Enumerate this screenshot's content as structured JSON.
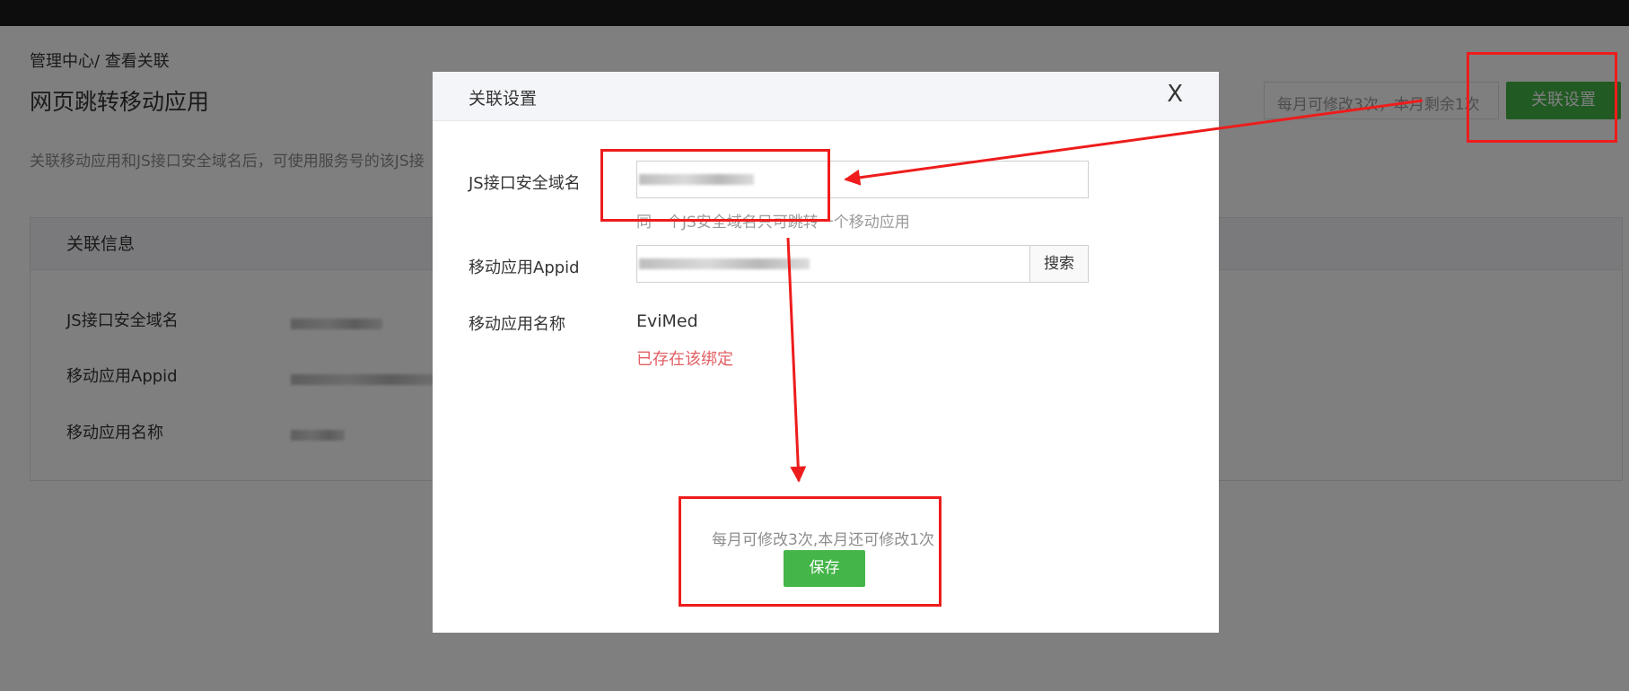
{
  "page": {
    "breadcrumb": "管理中心/ 查看关联",
    "title": "网页跳转移动应用",
    "quota_text": "每月可修改3次，本月剩余1次",
    "link_settings_button": "关联设置",
    "intro": "关联移动应用和JS接口安全域名后，可使用服务号的该JS接"
  },
  "info_card": {
    "header": "关联信息",
    "rows": [
      {
        "label": "JS接口安全域名"
      },
      {
        "label": "移动应用Appid"
      },
      {
        "label": "移动应用名称"
      }
    ]
  },
  "dialog": {
    "title": "关联设置",
    "close": "X",
    "js_domain_label": "JS接口安全域名",
    "js_domain_tip": "同一个JS安全域名只可跳转一个移动应用",
    "appid_label": "移动应用Appid",
    "search_button": "搜索",
    "app_name_label": "移动应用名称",
    "app_name_value": "EviMed",
    "error_text": "已存在该绑定",
    "limit_note": "每月可修改3次,本月还可修改1次",
    "save_button": "保存"
  },
  "colors": {
    "primary_green": "#44b549",
    "error_red": "#e15f63",
    "annotation_red": "#ee1c1c",
    "topbar": "#1a1a1a"
  }
}
